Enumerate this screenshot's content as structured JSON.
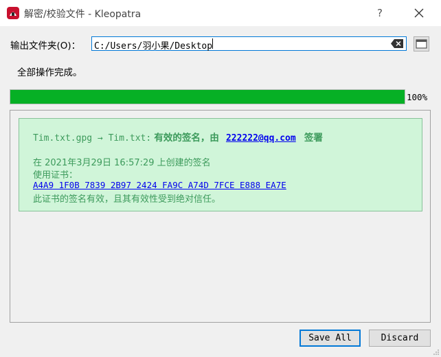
{
  "window": {
    "title": "解密/校验文件 - Kleopatra",
    "help_glyph": "?"
  },
  "output_folder": {
    "label": "输出文件夹(O)：",
    "value": "C:/Users/羽小果/Desktop"
  },
  "status": {
    "message": "全部操作完成。",
    "progress_percent": 100,
    "progress_label": "100%"
  },
  "result": {
    "file_transform": "Tim.txt.gpg → Tim.txt:",
    "valid_prefix": "有效的签名，由",
    "signer_email": "222222@qq.com",
    "signed_suffix": "签署",
    "created_line": "在 2021年3月29日 16:57:29 上创建的签名",
    "cert_label": "使用证书：",
    "cert_fingerprint": "A4A9 1F0B 7839 2B97 2424 FA9C A74D 7FCE E888 EA7E",
    "trust_message": "此证书的签名有效，且其有效性受到绝对信任。"
  },
  "buttons": {
    "save_all": "Save All",
    "discard": "Discard"
  },
  "icons": {
    "app": "kleopatra-icon",
    "close": "close-icon",
    "clear": "clear-input-icon",
    "browse": "folder-icon"
  },
  "colors": {
    "progress": "#06b025",
    "result_bg": "#d0f5d9",
    "result_text": "#3c9a5b",
    "link": "#0000ee"
  }
}
